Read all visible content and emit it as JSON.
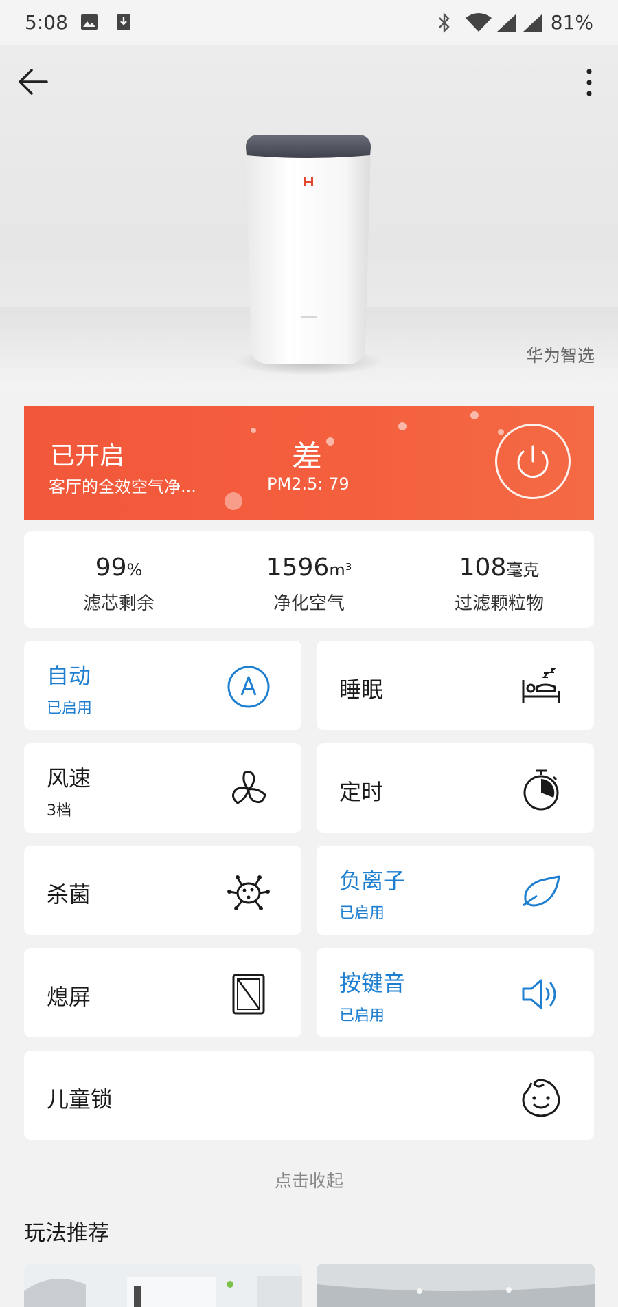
{
  "status_bar": {
    "time": "5:08",
    "battery": "81%"
  },
  "hero": {
    "brand_tag": "华为智选"
  },
  "device_status": {
    "state": "已开启",
    "name": "客厅的全效空气净...",
    "quality": "差",
    "pm25": "PM2.5: 79"
  },
  "stats": [
    {
      "value": "99",
      "unit": "%",
      "label": "滤芯剩余"
    },
    {
      "value": "1596",
      "unit": "m³",
      "label": "净化空气"
    },
    {
      "value": "108",
      "unit": "毫克",
      "label": "过滤颗粒物"
    }
  ],
  "controls": {
    "auto": {
      "title": "自动",
      "sub": "已启用",
      "icon": "auto-mode-icon"
    },
    "sleep": {
      "title": "睡眠",
      "icon": "sleep-icon"
    },
    "fan": {
      "title": "风速",
      "sub": "3档",
      "icon": "fan-icon"
    },
    "timer": {
      "title": "定时",
      "icon": "timer-icon"
    },
    "sterilize": {
      "title": "杀菌",
      "icon": "germ-icon"
    },
    "anion": {
      "title": "负离子",
      "sub": "已启用",
      "icon": "leaf-icon"
    },
    "screen_off": {
      "title": "熄屏",
      "icon": "screen-off-icon"
    },
    "key_sound": {
      "title": "按键音",
      "sub": "已启用",
      "icon": "speaker-icon"
    },
    "child_lock": {
      "title": "儿童锁",
      "icon": "child-face-icon"
    }
  },
  "collapse_label": "点击收起",
  "recommend_title": "玩法推荐",
  "colors": {
    "accent_blue": "#1e7fd0",
    "status_red": "#f2573a",
    "page_bg": "#f2f2f2"
  }
}
